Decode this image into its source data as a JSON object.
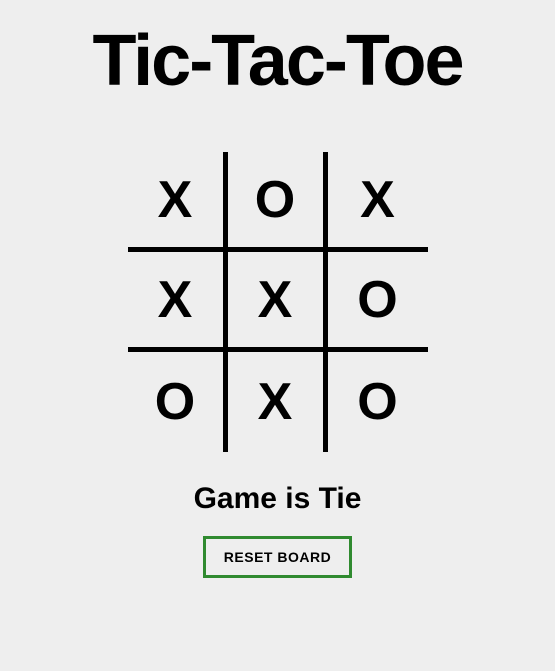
{
  "title": "Tic-Tac-Toe",
  "board": {
    "cells": [
      "X",
      "O",
      "X",
      "X",
      "X",
      "O",
      "O",
      "X",
      "O"
    ]
  },
  "status": "Game is Tie",
  "reset_label": "RESET BOARD",
  "colors": {
    "background": "#eeeeee",
    "border": "#000000",
    "button_border": "#2f8a2f"
  }
}
